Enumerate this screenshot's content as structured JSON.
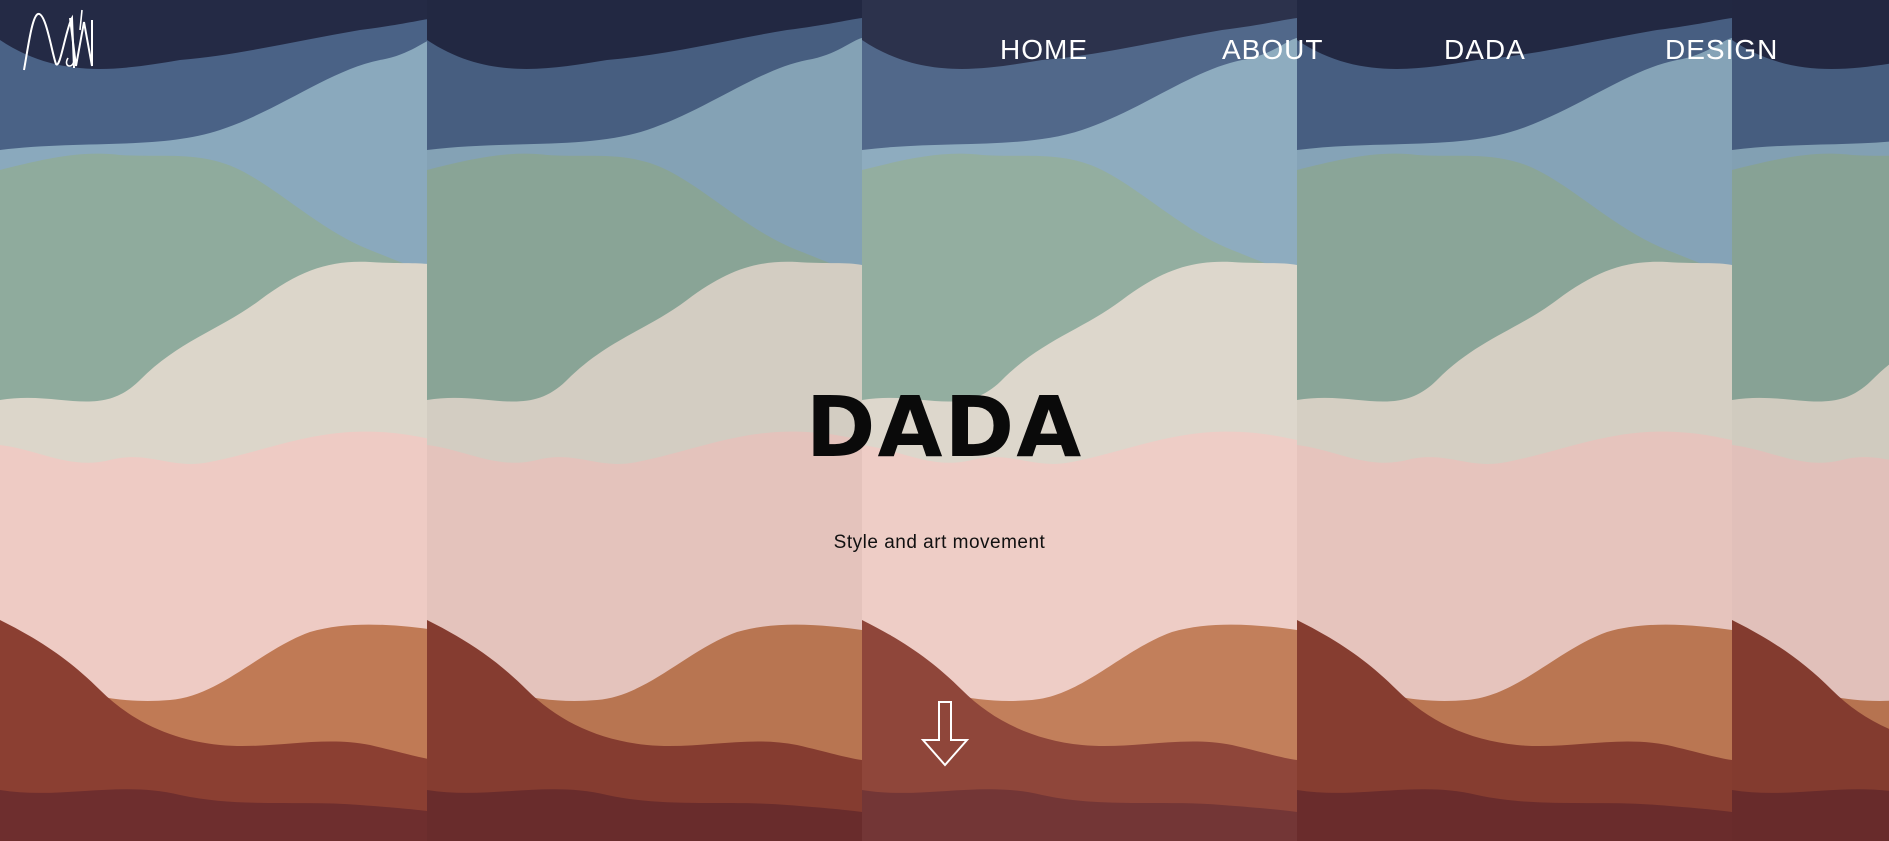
{
  "header": {
    "logo_icon": "nm-monogram-icon"
  },
  "nav": {
    "items": [
      {
        "label": "HOME"
      },
      {
        "label": "ABOUT"
      },
      {
        "label": "DADA"
      },
      {
        "label": "DESIGN"
      }
    ]
  },
  "hero": {
    "title": "DADA",
    "subtitle": "Style and art movement",
    "scroll_icon": "arrow-down-icon"
  },
  "colors": {
    "nav_text": "#ffffff",
    "title_text": "#0a0a0a",
    "navy": "#242a45",
    "slate_blue": "#4a6286",
    "light_blue": "#8aa9bd",
    "sage": "#8fab9d",
    "cream": "#dcd6ca",
    "blush": "#eecbc4",
    "terracotta": "#c07a55",
    "rust": "#8b3f32",
    "maroon": "#6e2e2e"
  }
}
